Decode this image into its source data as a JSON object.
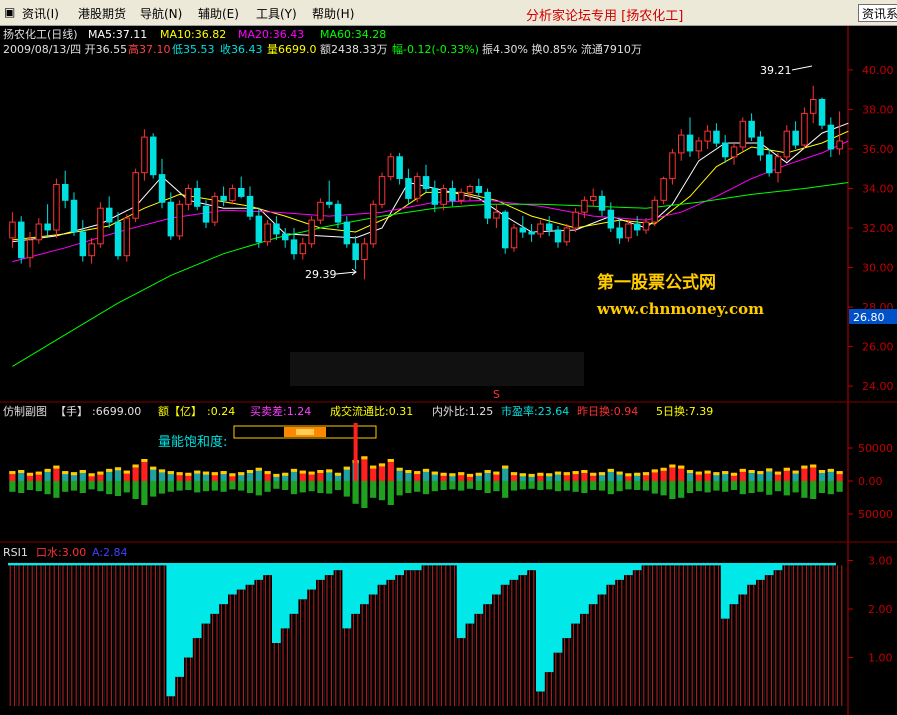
{
  "menu": [
    {
      "label": "资讯(I)"
    },
    {
      "label": "港股期货"
    },
    {
      "label": "导航(N)"
    },
    {
      "label": "辅助(E)"
    },
    {
      "label": "工具(Y)"
    },
    {
      "label": "帮助(H)"
    }
  ],
  "forum_title": "分析家论坛专用 [扬农化工]",
  "info_button_label": "资讯系",
  "stock": {
    "title": "扬农化工(日线)",
    "ma5": "MA5:37.11",
    "ma10": "MA10:36.82",
    "ma20": "MA20:36.43",
    "ma60": "MA60:34.28",
    "date_open": "2009/08/13/四 开36.55",
    "high": "高37.10",
    "low": "低35.53",
    "close": "收36.43",
    "volume": "量6699.0",
    "amount": "额2438.33万",
    "change": "幅-0.12(-0.33%)",
    "swing": "振4.30% 换0.85% 流通7910万"
  },
  "annotations": {
    "high_label": "39.21",
    "low_label": "29.39"
  },
  "watermark": {
    "line1": "第一股票公式网",
    "line2": "www.chnmoney.com"
  },
  "price_axis": {
    "ticks": [
      "40.00",
      "38.00",
      "36.00",
      "34.00",
      "32.00",
      "30.00",
      "28.00",
      "26.00",
      "24.00"
    ],
    "current_price": "26.80",
    "s_marker": "S"
  },
  "sub1": {
    "name": "仿制副图",
    "label_hand": "【手】",
    "value_hand": ":6699.00",
    "label_amount": "额【亿】",
    "value_amount": ":0.24",
    "buy_sell": "买卖差:1.24",
    "turnover_ratio": "成交流通比:0.31",
    "inout_ratio": "内外比:1.25",
    "pe": "市盈率:23.64",
    "prev_turnover": "昨日换:0.94",
    "five_day": "5日换:7.39",
    "saturation_label": "量能饱和度:",
    "ticks": [
      "50000",
      "0.00",
      "50000"
    ]
  },
  "sub2": {
    "name": "RSI1",
    "label_a": "口水:3.00",
    "label_b": "A:2.84",
    "ticks": [
      "3.00",
      "2.00",
      "1.00"
    ]
  },
  "colors": {
    "up": "#ff3232",
    "down": "#00e0e0",
    "ma5": "#ffffff",
    "ma10": "#ffff00",
    "ma20": "#ff00ff",
    "ma60": "#00ff00",
    "axis": "#c00000"
  },
  "chart_data": {
    "type": "candlestick",
    "note": "",
    "price_range": [
      23.5,
      40.5
    ],
    "candles": [
      [
        31.5,
        32.8,
        31.0,
        32.3
      ],
      [
        32.3,
        32.6,
        30.2,
        30.5
      ],
      [
        30.5,
        31.8,
        30.0,
        31.4
      ],
      [
        31.4,
        32.5,
        31.2,
        32.2
      ],
      [
        32.2,
        33.2,
        31.6,
        31.9
      ],
      [
        31.9,
        34.5,
        31.5,
        34.2
      ],
      [
        34.2,
        34.9,
        33.0,
        33.4
      ],
      [
        33.4,
        33.8,
        31.6,
        31.8
      ],
      [
        31.8,
        32.4,
        30.3,
        30.6
      ],
      [
        30.6,
        31.5,
        30.2,
        31.2
      ],
      [
        31.2,
        33.3,
        31.0,
        33.0
      ],
      [
        33.0,
        33.6,
        32.0,
        32.3
      ],
      [
        32.3,
        32.8,
        30.4,
        30.6
      ],
      [
        30.6,
        32.7,
        30.3,
        32.5
      ],
      [
        32.5,
        35.0,
        32.3,
        34.8
      ],
      [
        34.8,
        37.0,
        34.4,
        36.6
      ],
      [
        36.6,
        36.8,
        34.5,
        34.7
      ],
      [
        34.7,
        35.5,
        33.0,
        33.3
      ],
      [
        33.3,
        33.8,
        31.4,
        31.6
      ],
      [
        31.6,
        33.4,
        31.4,
        33.2
      ],
      [
        33.2,
        34.2,
        32.9,
        34.0
      ],
      [
        34.0,
        34.4,
        32.9,
        33.1
      ],
      [
        33.1,
        33.4,
        32.0,
        32.3
      ],
      [
        32.3,
        33.8,
        32.1,
        33.6
      ],
      [
        33.6,
        34.1,
        33.1,
        33.4
      ],
      [
        33.4,
        34.2,
        33.2,
        34.0
      ],
      [
        34.0,
        34.6,
        33.5,
        33.6
      ],
      [
        33.6,
        34.1,
        32.4,
        32.6
      ],
      [
        32.6,
        33.0,
        31.0,
        31.3
      ],
      [
        31.3,
        32.4,
        31.1,
        32.2
      ],
      [
        32.2,
        32.6,
        31.4,
        31.7
      ],
      [
        31.7,
        32.0,
        31.0,
        31.4
      ],
      [
        31.4,
        32.0,
        30.4,
        30.7
      ],
      [
        30.7,
        31.5,
        30.4,
        31.2
      ],
      [
        31.2,
        32.6,
        31.0,
        32.4
      ],
      [
        32.4,
        33.5,
        32.2,
        33.3
      ],
      [
        33.3,
        34.4,
        33.0,
        33.2
      ],
      [
        33.2,
        33.4,
        32.0,
        32.3
      ],
      [
        32.3,
        32.6,
        31.0,
        31.2
      ],
      [
        31.2,
        31.6,
        29.9,
        30.4
      ],
      [
        30.4,
        31.5,
        29.4,
        31.2
      ],
      [
        31.2,
        33.4,
        31.0,
        33.2
      ],
      [
        33.2,
        34.8,
        33.0,
        34.6
      ],
      [
        34.6,
        35.8,
        34.4,
        35.6
      ],
      [
        35.6,
        35.8,
        34.2,
        34.5
      ],
      [
        34.5,
        35.0,
        33.2,
        33.5
      ],
      [
        33.5,
        34.8,
        33.3,
        34.6
      ],
      [
        34.6,
        35.2,
        33.8,
        34.0
      ],
      [
        34.0,
        34.4,
        32.8,
        33.2
      ],
      [
        33.2,
        34.2,
        32.9,
        34.0
      ],
      [
        34.0,
        34.4,
        33.1,
        33.4
      ],
      [
        33.4,
        34.0,
        33.2,
        33.8
      ],
      [
        33.8,
        34.2,
        33.4,
        34.1
      ],
      [
        34.1,
        34.5,
        33.6,
        33.8
      ],
      [
        33.8,
        34.0,
        32.2,
        32.5
      ],
      [
        32.5,
        33.2,
        32.0,
        32.8
      ],
      [
        32.8,
        32.9,
        30.7,
        31.0
      ],
      [
        31.0,
        32.2,
        30.8,
        32.0
      ],
      [
        32.0,
        32.6,
        31.5,
        31.8
      ],
      [
        31.8,
        32.2,
        31.3,
        31.7
      ],
      [
        31.7,
        32.4,
        31.5,
        32.2
      ],
      [
        32.2,
        32.6,
        31.6,
        31.9
      ],
      [
        31.9,
        32.1,
        31.0,
        31.3
      ],
      [
        31.3,
        32.2,
        31.1,
        32.0
      ],
      [
        32.0,
        33.0,
        31.8,
        32.8
      ],
      [
        32.8,
        33.6,
        32.5,
        33.4
      ],
      [
        33.4,
        34.0,
        33.1,
        33.6
      ],
      [
        33.6,
        33.9,
        32.6,
        32.9
      ],
      [
        32.9,
        33.3,
        31.8,
        32.0
      ],
      [
        32.0,
        32.5,
        31.2,
        31.5
      ],
      [
        31.5,
        32.4,
        31.3,
        32.2
      ],
      [
        32.2,
        32.6,
        31.6,
        31.9
      ],
      [
        31.9,
        32.5,
        31.7,
        32.3
      ],
      [
        32.3,
        33.6,
        32.1,
        33.4
      ],
      [
        33.4,
        34.6,
        33.2,
        34.5
      ],
      [
        34.5,
        36.0,
        34.2,
        35.8
      ],
      [
        35.8,
        37.0,
        35.4,
        36.7
      ],
      [
        36.7,
        37.6,
        35.6,
        35.9
      ],
      [
        35.9,
        36.6,
        35.5,
        36.4
      ],
      [
        36.4,
        37.2,
        36.0,
        36.9
      ],
      [
        36.9,
        37.3,
        36.1,
        36.3
      ],
      [
        36.3,
        36.7,
        35.3,
        35.6
      ],
      [
        35.6,
        36.3,
        35.2,
        36.1
      ],
      [
        36.1,
        37.6,
        35.9,
        37.4
      ],
      [
        37.4,
        37.8,
        36.4,
        36.6
      ],
      [
        36.6,
        36.9,
        35.4,
        35.7
      ],
      [
        35.7,
        36.0,
        34.6,
        34.8
      ],
      [
        34.8,
        35.8,
        34.3,
        35.6
      ],
      [
        35.6,
        37.2,
        35.4,
        36.9
      ],
      [
        36.9,
        37.4,
        36.0,
        36.2
      ],
      [
        36.2,
        38.1,
        36.0,
        37.8
      ],
      [
        37.8,
        39.2,
        37.3,
        38.5
      ],
      [
        38.5,
        38.6,
        37.0,
        37.2
      ],
      [
        37.2,
        37.6,
        35.6,
        36.0
      ],
      [
        36.0,
        37.9,
        35.7,
        36.4
      ]
    ],
    "ma": [
      {
        "name": "MA5",
        "color": "#ffffff",
        "points": [
          [
            0,
            31.3
          ],
          [
            5,
            31.6
          ],
          [
            10,
            32.2
          ],
          [
            14,
            33.1
          ],
          [
            17,
            34.6
          ],
          [
            20,
            33.4
          ],
          [
            24,
            33.0
          ],
          [
            28,
            33.0
          ],
          [
            31,
            31.7
          ],
          [
            35,
            31.6
          ],
          [
            39,
            31.5
          ],
          [
            42,
            32.0
          ],
          [
            45,
            34.3
          ],
          [
            49,
            33.9
          ],
          [
            53,
            33.5
          ],
          [
            56,
            32.6
          ],
          [
            59,
            31.8
          ],
          [
            64,
            31.9
          ],
          [
            68,
            32.6
          ],
          [
            72,
            32.0
          ],
          [
            75,
            33.2
          ],
          [
            78,
            35.4
          ],
          [
            81,
            36.3
          ],
          [
            85,
            36.3
          ],
          [
            88,
            35.3
          ],
          [
            92,
            36.8
          ],
          [
            95,
            37.3
          ]
        ]
      },
      {
        "name": "MA10",
        "color": "#ffff00",
        "points": [
          [
            0,
            31.4
          ],
          [
            6,
            31.7
          ],
          [
            11,
            32.1
          ],
          [
            15,
            33.0
          ],
          [
            19,
            33.7
          ],
          [
            23,
            33.4
          ],
          [
            27,
            33.1
          ],
          [
            31,
            32.6
          ],
          [
            35,
            32.0
          ],
          [
            39,
            31.8
          ],
          [
            43,
            32.6
          ],
          [
            47,
            33.8
          ],
          [
            51,
            33.8
          ],
          [
            55,
            33.4
          ],
          [
            59,
            32.6
          ],
          [
            64,
            32.0
          ],
          [
            69,
            32.4
          ],
          [
            73,
            32.2
          ],
          [
            77,
            33.6
          ],
          [
            80,
            35.1
          ],
          [
            84,
            36.1
          ],
          [
            88,
            35.8
          ],
          [
            92,
            36.3
          ],
          [
            95,
            36.9
          ]
        ]
      },
      {
        "name": "MA20",
        "color": "#ff00ff",
        "points": [
          [
            0,
            30.3
          ],
          [
            6,
            31.0
          ],
          [
            12,
            31.8
          ],
          [
            18,
            32.5
          ],
          [
            24,
            32.9
          ],
          [
            30,
            32.8
          ],
          [
            36,
            32.6
          ],
          [
            42,
            32.8
          ],
          [
            48,
            33.3
          ],
          [
            54,
            33.4
          ],
          [
            60,
            33.1
          ],
          [
            66,
            32.6
          ],
          [
            72,
            32.4
          ],
          [
            76,
            32.8
          ],
          [
            80,
            33.6
          ],
          [
            84,
            34.5
          ],
          [
            88,
            35.2
          ],
          [
            92,
            35.8
          ],
          [
            95,
            36.4
          ]
        ]
      },
      {
        "name": "MA60",
        "color": "#00ff00",
        "points": [
          [
            0,
            25.0
          ],
          [
            6,
            26.6
          ],
          [
            12,
            28.2
          ],
          [
            18,
            29.6
          ],
          [
            24,
            30.7
          ],
          [
            30,
            31.5
          ],
          [
            36,
            32.1
          ],
          [
            42,
            32.6
          ],
          [
            48,
            33.0
          ],
          [
            54,
            33.2
          ],
          [
            60,
            33.2
          ],
          [
            66,
            33.1
          ],
          [
            72,
            33.0
          ],
          [
            78,
            33.3
          ],
          [
            84,
            33.7
          ],
          [
            90,
            34.0
          ],
          [
            95,
            34.3
          ]
        ]
      }
    ],
    "volume_range": [
      -60000,
      95000
    ],
    "volumes": [
      18,
      20,
      15,
      17,
      22,
      28,
      18,
      16,
      20,
      14,
      17,
      22,
      25,
      19,
      30,
      40,
      26,
      21,
      18,
      16,
      15,
      19,
      17,
      16,
      18,
      14,
      16,
      20,
      24,
      18,
      13,
      15,
      22,
      19,
      17,
      20,
      21,
      15,
      26,
      38,
      45,
      28,
      32,
      40,
      24,
      20,
      18,
      22,
      17,
      15,
      14,
      16,
      13,
      15,
      20,
      17,
      28,
      16,
      14,
      13,
      15,
      14,
      17,
      16,
      18,
      20,
      15,
      16,
      22,
      17,
      14,
      15,
      16,
      21,
      24,
      30,
      28,
      20,
      17,
      19,
      16,
      18,
      15,
      22,
      20,
      18,
      23,
      17,
      24,
      19,
      28,
      30,
      20,
      22,
      18
    ],
    "rsi_range": [
      0,
      3.3
    ],
    "rsi": [
      2.9,
      2.9,
      2.9,
      2.9,
      2.9,
      2.9,
      2.9,
      2.9,
      2.9,
      2.9,
      2.9,
      2.9,
      2.9,
      2.9,
      2.9,
      2.9,
      2.9,
      2.9,
      0.2,
      0.6,
      1.0,
      1.4,
      1.7,
      1.9,
      2.1,
      2.3,
      2.4,
      2.5,
      2.6,
      2.7,
      1.3,
      1.6,
      1.9,
      2.2,
      2.4,
      2.6,
      2.7,
      2.8,
      1.6,
      1.9,
      2.1,
      2.3,
      2.5,
      2.6,
      2.7,
      2.8,
      2.8,
      2.9,
      2.9,
      2.9,
      2.9,
      1.4,
      1.7,
      1.9,
      2.1,
      2.3,
      2.5,
      2.6,
      2.7,
      2.8,
      0.3,
      0.7,
      1.1,
      1.4,
      1.7,
      1.9,
      2.1,
      2.3,
      2.5,
      2.6,
      2.7,
      2.8,
      2.9,
      2.9,
      2.9,
      2.9,
      2.9,
      2.9,
      2.9,
      2.9,
      2.9,
      1.8,
      2.1,
      2.3,
      2.5,
      2.6,
      2.7,
      2.8,
      2.9,
      2.9,
      2.9,
      2.9,
      2.9,
      2.9,
      2.9
    ]
  }
}
